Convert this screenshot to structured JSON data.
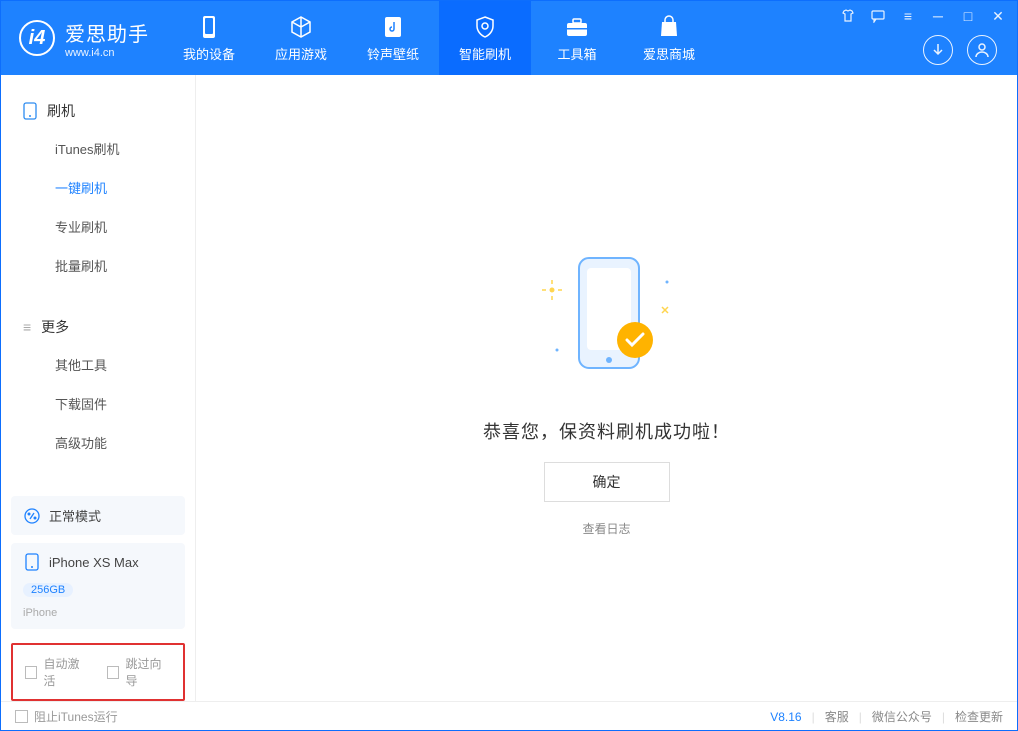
{
  "app": {
    "name_cn": "爱思助手",
    "name_en": "www.i4.cn"
  },
  "tabs": [
    {
      "label": "我的设备",
      "icon": "phone"
    },
    {
      "label": "应用游戏",
      "icon": "cube"
    },
    {
      "label": "铃声壁纸",
      "icon": "music"
    },
    {
      "label": "智能刷机",
      "icon": "shield",
      "active": true
    },
    {
      "label": "工具箱",
      "icon": "toolbox"
    },
    {
      "label": "爱思商城",
      "icon": "bag"
    }
  ],
  "sidebar": {
    "section1": {
      "title": "刷机",
      "items": [
        "iTunes刷机",
        "一键刷机",
        "专业刷机",
        "批量刷机"
      ],
      "activeIndex": 1
    },
    "section2": {
      "title": "更多",
      "items": [
        "其他工具",
        "下载固件",
        "高级功能"
      ]
    }
  },
  "device": {
    "mode_label": "正常模式",
    "name": "iPhone XS Max",
    "storage": "256GB",
    "type": "iPhone"
  },
  "checkboxes": {
    "auto_activate": "自动激活",
    "skip_guide": "跳过向导"
  },
  "main": {
    "success_text": "恭喜您，保资料刷机成功啦！",
    "ok_button": "确定",
    "view_log": "查看日志"
  },
  "footer": {
    "block_itunes": "阻止iTunes运行",
    "version": "V8.16",
    "support": "客服",
    "wechat": "微信公众号",
    "check_update": "检查更新"
  }
}
